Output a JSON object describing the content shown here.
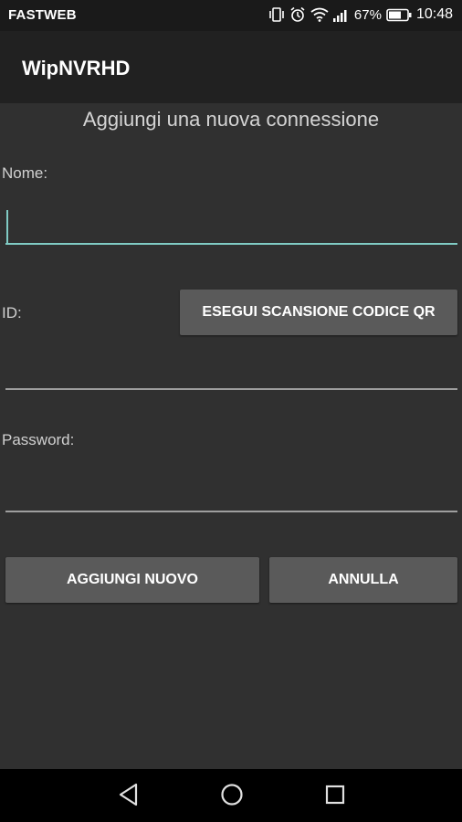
{
  "status_bar": {
    "carrier": "FASTWEB",
    "battery_percent": "67%",
    "time": "10:48",
    "icons": [
      "vibrate-icon",
      "alarm-icon",
      "wifi-icon",
      "signal-icon",
      "battery-icon"
    ]
  },
  "app_bar": {
    "title": "WipNVRHD"
  },
  "form": {
    "heading": "Aggiungi una nuova connessione",
    "name_label": "Nome:",
    "name_value": "",
    "id_label": "ID:",
    "id_value": "",
    "scan_qr_label": "ESEGUI SCANSIONE CODICE QR",
    "password_label": "Password:",
    "password_value": ""
  },
  "actions": {
    "add_label": "AGGIUNGI NUOVO",
    "cancel_label": "ANNULLA"
  },
  "nav_bar": {
    "icons": [
      "back-icon",
      "home-icon",
      "recents-icon"
    ]
  },
  "colors": {
    "background": "#303030",
    "app_bar": "#212121",
    "status_bar": "#1a1a1a",
    "accent": "#80cbc4",
    "button": "#5a5a5a"
  }
}
